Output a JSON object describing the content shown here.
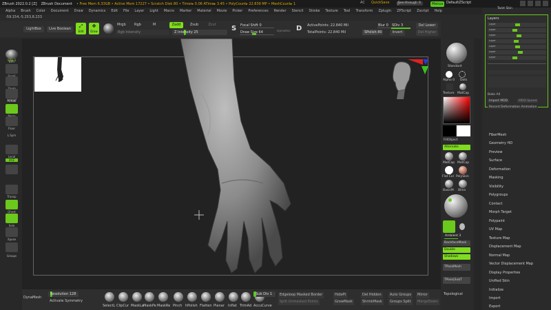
{
  "titlebar": {
    "app": "ZBrush 2022.0.2 [Z]",
    "document": "ZBrush Document",
    "stats": "• Free Mem 6.33GB • Active Mem 17227 • Scratch Disk 80 • Timer▸ 0.06 ATime▸ 3.45 • PolyCount▸ 22.839 MP • MeshCount▸ 1",
    "ac": "AC",
    "quicksave": "QuickSave",
    "seethrough": "See-through",
    "seethrough_value": "0",
    "menus": "Menus",
    "defaultzscript": "DefaultZScript"
  },
  "menubar": {
    "items": [
      "Alpha",
      "Brush",
      "Color",
      "Document",
      "Draw",
      "Dynamics",
      "Edit",
      "File",
      "Layer",
      "Light",
      "Macro",
      "Marker",
      "Material",
      "Movie",
      "Picker",
      "Preferences",
      "Render",
      "Stencil",
      "Stroke",
      "Texture",
      "Tool",
      "Transform",
      "Zplugin",
      "ZPScript",
      "Zscript",
      "Help"
    ]
  },
  "coords": "-59.154,-5.253,8.233",
  "shelf": {
    "lightbox": "LightBox",
    "liveboolean": "Live Boolean",
    "edit": "Edit",
    "draw": "Draw",
    "mrgb": "Mrgb",
    "rgb": "Rgb",
    "m": "M",
    "rgb_intensity": "Rgb Intensity",
    "zadd": "Zadd",
    "zsub": "Zsub",
    "zcut": "Zcut",
    "z_intensity": "Z Intensity",
    "z_intensity_value": "25",
    "focal_shift": "Focal Shift",
    "focal_shift_value": "0",
    "draw_size": "Draw Size",
    "draw_size_value": "64",
    "dynamic": "Dynamic",
    "active_points": "ActivePoints: 22.840 Mil",
    "total_points": "TotalPoints: 22.840 Mil",
    "spolish": "SPolish",
    "spolish_value": "80",
    "sdiv": "SDiv",
    "sdiv_value": "3",
    "del_lower": "Del Lower",
    "del_higher": "Del Higher",
    "blur": "Blur",
    "blur_value": "0",
    "invert": "Invert",
    "s_letter": "S",
    "d_letter": "D"
  },
  "lefttool": {
    "items": [
      "BPR",
      "SPix 3",
      "Scroll",
      "Zoom",
      "Actual",
      "AAHalf",
      "Persp",
      "Floor",
      "L.Sym",
      "Local",
      "XYZ",
      "",
      "Transp",
      "Ghost",
      "Solo",
      "Dynamic",
      "Xpose",
      "Groups"
    ]
  },
  "bottom": {
    "dynamesh": "DynaMesh",
    "resolution": "Resolution",
    "resolution_value": "128",
    "activate_symmetry": "Activate Symmetry",
    "brushes": [
      "SelectL",
      "ClipCur",
      "MaskLa",
      "MaskPe",
      "MaskRe",
      "Pinch",
      "hPolish",
      "Flatten",
      "Planar",
      "Inflat",
      "TrimAd",
      "AccuCurve"
    ],
    "sub_div": "Sub Div",
    "sub_div_value": "1",
    "edgeloop": "Edgeloop Masked Border",
    "split_unmasked": "Split Unmasked Points",
    "hidept": "HidePt",
    "growmask": "GrowMask",
    "del_hidden": "Del Hidden",
    "shrinkmask": "ShrinkMask",
    "auto_groups": "Auto Groups",
    "groups_split": "Groups Split",
    "mirror": "Mirror",
    "merge_down": "MergeDown",
    "topological": "Topological"
  },
  "rpal": {
    "standard": "Standard",
    "alpha": "Alpha 0",
    "dots": "Dots",
    "texture": "Texture",
    "matcap": "MatCap",
    "fillobject": "FillObject",
    "alternate": "Alternate",
    "matcap_a": "MatCap",
    "matcap_b": "MatCap",
    "flat_col": "Flat Col",
    "polyskin": "PolySkin",
    "basicm": "BasicM",
    "blinn": "Blinn",
    "ambient": "Ambient",
    "ambient_value": "3",
    "backfacemask": "BackfaceMask",
    "double": "Double",
    "shadows": "Shadows",
    "tposemesh": "TPoseMesh",
    "tpose_subt": "TPose|SubT"
  },
  "rmenu": {
    "layers_title": "Layers",
    "layer_rows": [
      "Layer",
      "Layer",
      "Layer",
      "Layer",
      "Layer",
      "Layer",
      "Layer"
    ],
    "bake_all": "Bake All",
    "import_mdd": "Import MDD",
    "mdd_speed": "MDD Speed",
    "record_deformation": "Record Deformation Animation",
    "items": [
      "FiberMesh",
      "Geometry HD",
      "Preview",
      "Surface",
      "Deformation",
      "Masking",
      "Visibility",
      "Polygroups",
      "Contact",
      "Morph Target",
      "Polypaint",
      "UV Map",
      "Texture Map",
      "Displacement Map",
      "Normal Map",
      "Vector Displacement Map",
      "Display Properties",
      "Unified Skin",
      "Initialize",
      "Import",
      "Export"
    ],
    "twist_skin": "Twist Skin"
  },
  "colors": {
    "accent": "#7fdc1e",
    "title_info": "#d8a800"
  }
}
